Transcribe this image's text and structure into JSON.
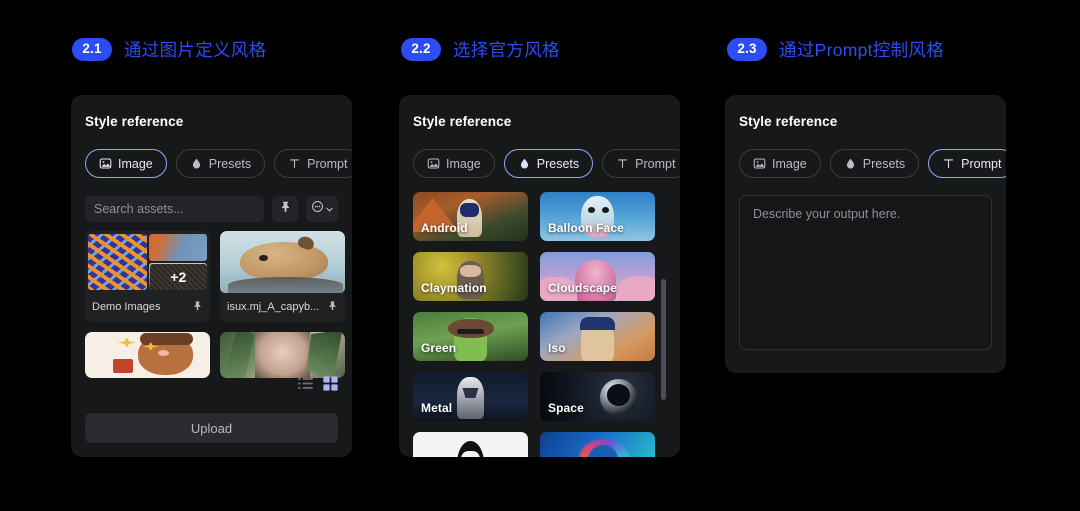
{
  "columns": [
    {
      "badge": "2.1",
      "title": "通过图片定义风格"
    },
    {
      "badge": "2.2",
      "title": "选择官方风格"
    },
    {
      "badge": "2.3",
      "title": "通过Prompt控制风格"
    }
  ],
  "panel_title": "Style reference",
  "tabs": [
    {
      "label": "Image",
      "icon": "image-icon"
    },
    {
      "label": "Presets",
      "icon": "droplet-icon"
    },
    {
      "label": "Prompt",
      "icon": "text-icon"
    }
  ],
  "active_tab": {
    "panel1": "Image",
    "panel2": "Presets",
    "panel3": "Prompt"
  },
  "search": {
    "placeholder": "Search assets...",
    "pin_icon": "pin-icon",
    "more_icon": "more-circle-icon",
    "caret_icon": "chevron-down-icon"
  },
  "assets": [
    {
      "name": "Demo Images",
      "type": "folder",
      "overlay": "+2",
      "pin_icon": "pin-icon"
    },
    {
      "name": "isux.mj_A_capyb...",
      "type": "image",
      "pin_icon": "pin-icon"
    },
    {
      "name": "",
      "type": "image"
    },
    {
      "name": "",
      "type": "image"
    }
  ],
  "view_toggle": {
    "list_icon": "list-view-icon",
    "grid_icon": "grid-view-icon",
    "active": "grid"
  },
  "upload_label": "Upload",
  "presets": [
    {
      "label": "Android"
    },
    {
      "label": "Balloon Face"
    },
    {
      "label": "Claymation"
    },
    {
      "label": "Cloudscape"
    },
    {
      "label": "Green"
    },
    {
      "label": "Iso"
    },
    {
      "label": "Metal"
    },
    {
      "label": "Space"
    },
    {
      "label": ""
    },
    {
      "label": ""
    }
  ],
  "prompt": {
    "placeholder": "Describe your output here.",
    "value": ""
  },
  "colors": {
    "page_background": "#000000",
    "panel_background": "#17181a",
    "accent_blue": "#2c4cf4",
    "active_border": "#9aa2f0",
    "muted_text": "#8d9096"
  }
}
